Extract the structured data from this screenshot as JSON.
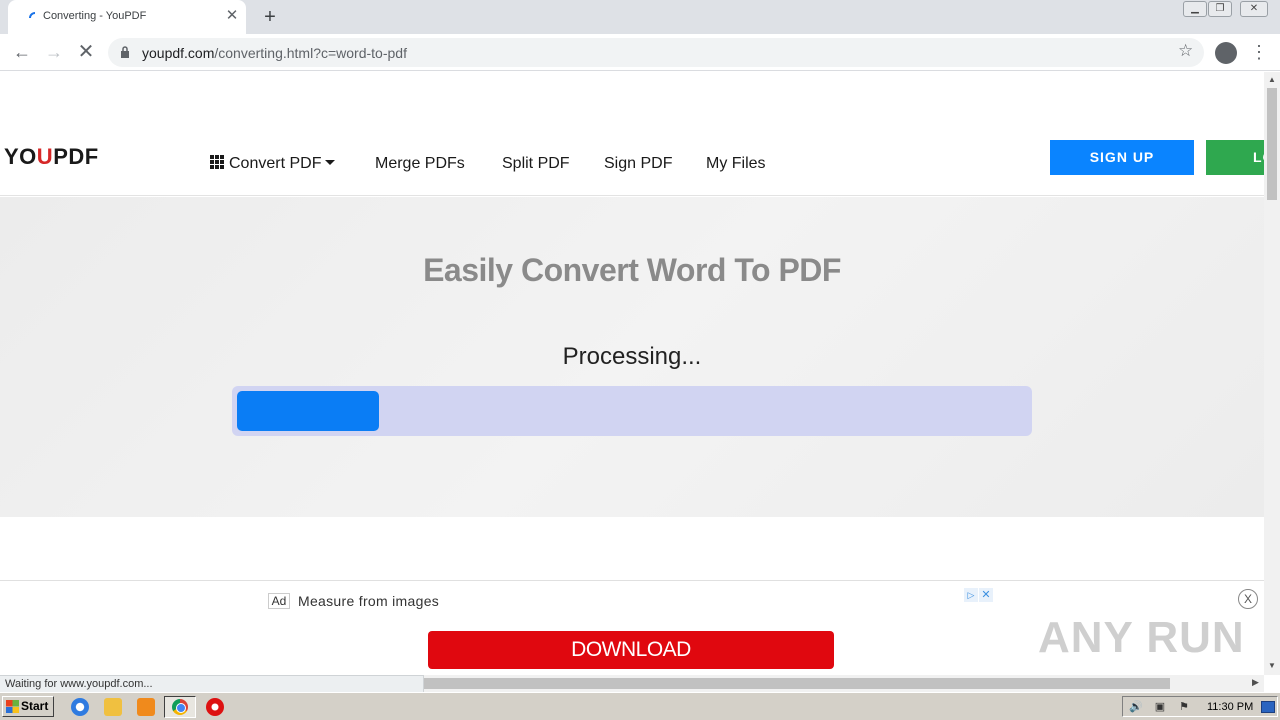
{
  "browser": {
    "tab_title": "Converting - YouPDF",
    "tab_close": "✕",
    "new_tab": "+",
    "url_host": "youpdf.com",
    "url_path": "/converting.html?c=word-to-pdf",
    "status_text": "Waiting for www.youpdf.com..."
  },
  "site": {
    "logo_left": "YO",
    "logo_mark": "U",
    "logo_right": "PDF",
    "nav": {
      "convert": "Convert PDF",
      "merge": "Merge PDFs",
      "split": "Split PDF",
      "sign": "Sign PDF",
      "files": "My Files"
    },
    "signup": "SIGN UP",
    "login": "LOGIN"
  },
  "converter": {
    "title": "Easily Convert Word To PDF",
    "status": "Processing...",
    "progress_fraction": 0.18
  },
  "ad": {
    "label": "Ad",
    "text": "Measure from images",
    "button": "DOWNLOAD",
    "dismiss": "X"
  },
  "watermark": "ANY RUN",
  "taskbar": {
    "start": "Start",
    "clock": "11:30 PM"
  },
  "colors": {
    "accent_blue": "#0a84ff",
    "login_green": "#2fa84f",
    "progress_track": "#d1d4f2",
    "progress_fill": "#0a7df5",
    "ad_button": "#e0080f"
  }
}
